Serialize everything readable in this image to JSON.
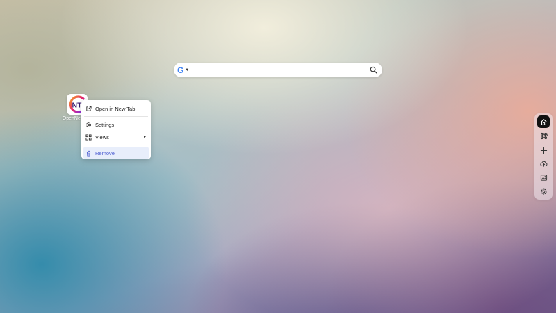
{
  "search": {
    "engine_icon": "google-icon",
    "engine_glyph": "G",
    "value": "",
    "placeholder": "",
    "search_icon": "search-icon"
  },
  "shortcut": {
    "label": "OpenNewTab",
    "logo_icon": "nt-logo-icon",
    "logo_text": "NT"
  },
  "context_menu": {
    "items": [
      {
        "label": "Open in New Tab",
        "icon": "external-link-icon"
      },
      {
        "label": "Settings",
        "icon": "gear-icon"
      },
      {
        "label": "Views",
        "icon": "grid-icon",
        "submenu_arrow": "▸"
      },
      {
        "label": "Remove",
        "icon": "trash-icon",
        "highlighted": true
      }
    ]
  },
  "dock": {
    "items": [
      {
        "icon": "home-icon",
        "active": true
      },
      {
        "icon": "command-icon",
        "active": false
      },
      {
        "icon": "plus-icon",
        "active": false
      },
      {
        "icon": "cloud-upload-icon",
        "active": false
      },
      {
        "icon": "image-icon",
        "active": false
      },
      {
        "icon": "gear-icon",
        "active": false
      }
    ]
  },
  "colors": {
    "menu_highlight_bg": "#e8eefb",
    "menu_highlight_text": "#4a5bd0",
    "dock_active_bg": "#111111",
    "google_blue": "#4285F4"
  }
}
